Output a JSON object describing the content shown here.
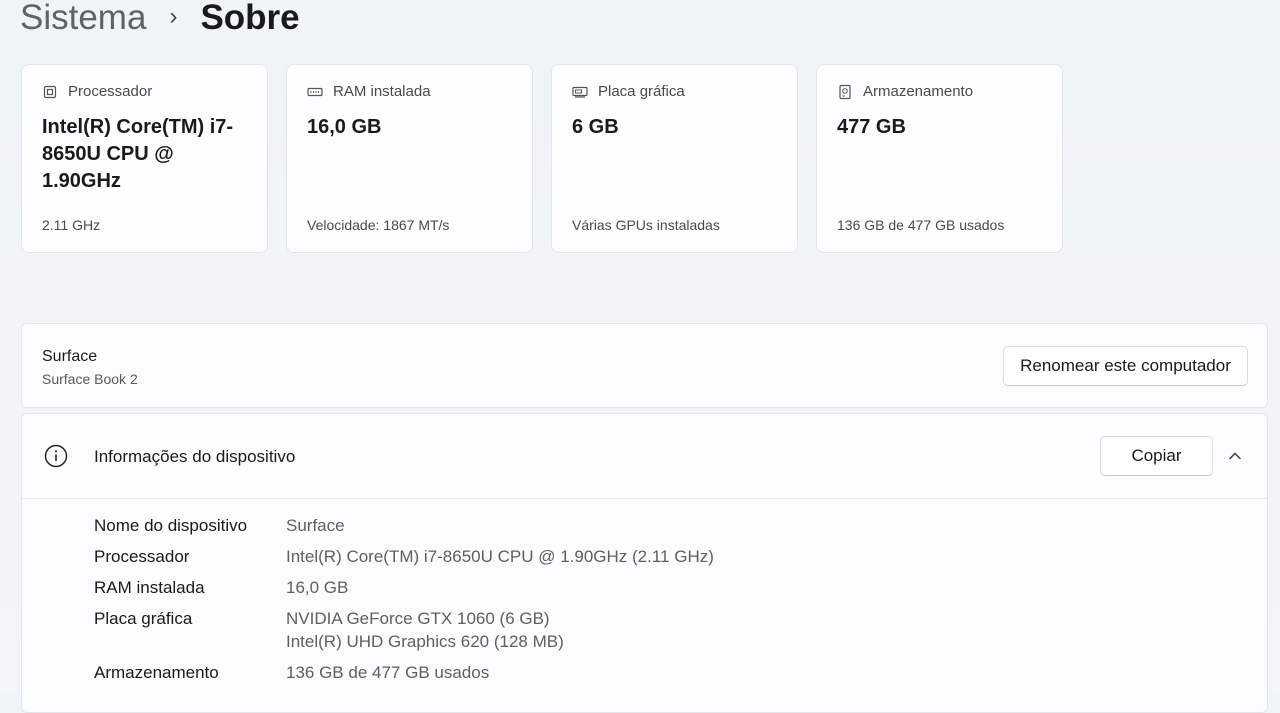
{
  "breadcrumb": {
    "parent": "Sistema",
    "separator": "›",
    "current": "Sobre"
  },
  "cards": [
    {
      "icon": "processor-icon",
      "label": "Processador",
      "value": "Intel(R) Core(TM) i7-8650U CPU @ 1.90GHz",
      "sub": "2.11 GHz"
    },
    {
      "icon": "ram-icon",
      "label": "RAM instalada",
      "value": "16,0 GB",
      "sub": "Velocidade: 1867 MT/s"
    },
    {
      "icon": "gpu-icon",
      "label": "Placa gráfica",
      "value": "6 GB",
      "sub": "Várias GPUs instaladas"
    },
    {
      "icon": "storage-icon",
      "label": "Armazenamento",
      "value": "477 GB",
      "sub": "136 GB de 477 GB usados"
    }
  ],
  "device": {
    "name": "Surface",
    "model": "Surface Book 2",
    "rename_label": "Renomear este computador"
  },
  "info": {
    "title": "Informações do dispositivo",
    "copy_label": "Copiar",
    "rows": [
      {
        "label": "Nome do dispositivo",
        "value": "Surface",
        "value2": ""
      },
      {
        "label": "Processador",
        "value": "Intel(R) Core(TM) i7-8650U CPU @ 1.90GHz (2.11 GHz)",
        "value2": ""
      },
      {
        "label": "RAM instalada",
        "value": "16,0 GB",
        "value2": ""
      },
      {
        "label": "Placa gráfica",
        "value": "NVIDIA GeForce GTX 1060 (6 GB)",
        "value2": "Intel(R) UHD Graphics 620 (128 MB)"
      },
      {
        "label": "Armazenamento",
        "value": "136 GB de 477 GB usados",
        "value2": ""
      }
    ]
  }
}
